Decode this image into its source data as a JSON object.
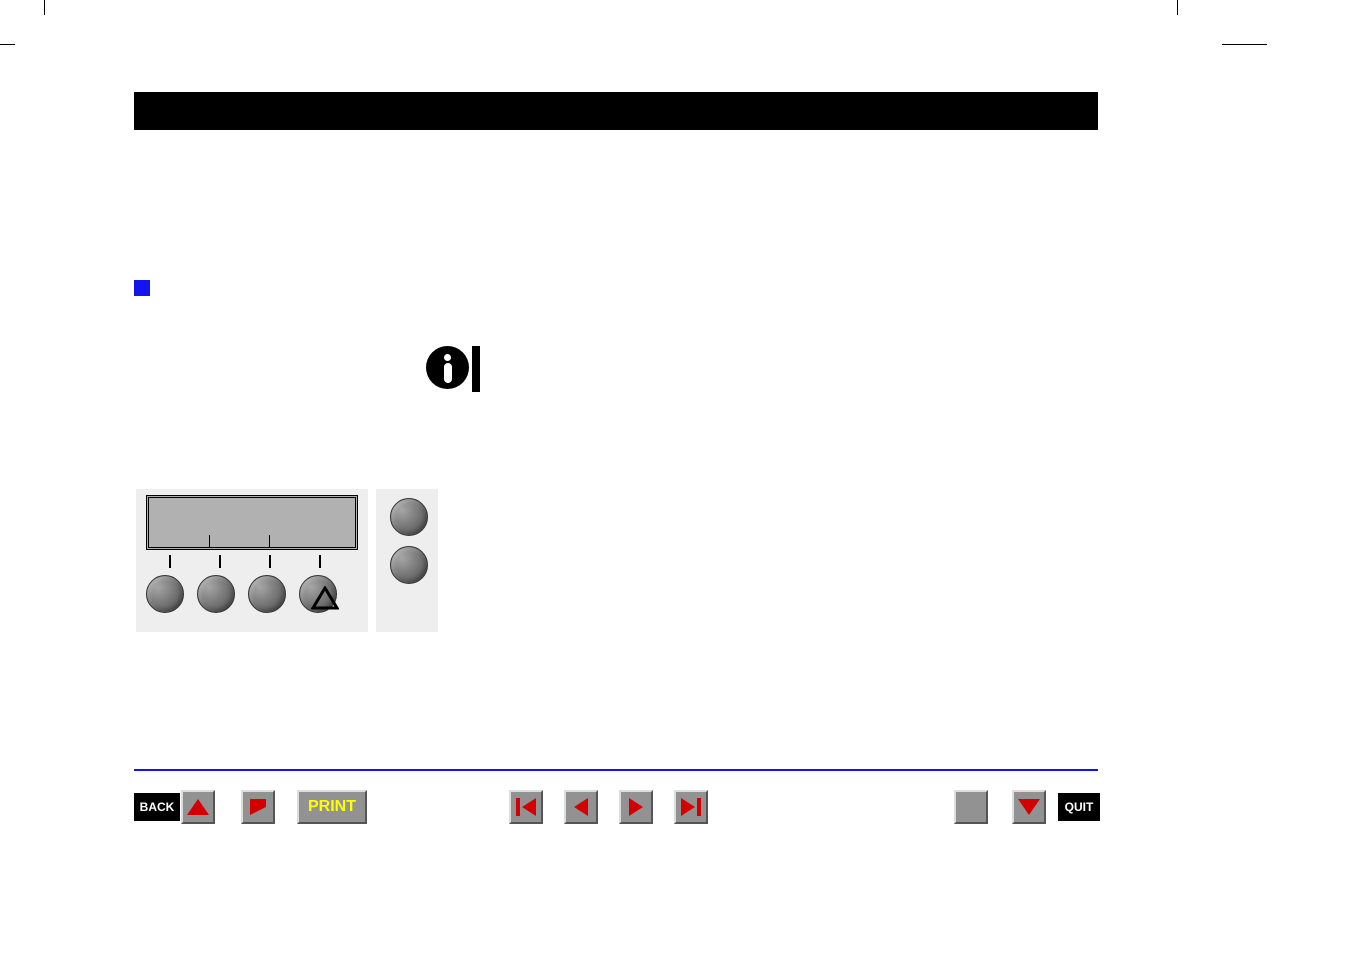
{
  "footer": {
    "back_label": "BACK",
    "print_label": "PRINT",
    "quit_label": "QUIT"
  },
  "icons": {
    "info": "info-icon",
    "bullet": "square-bullet"
  }
}
